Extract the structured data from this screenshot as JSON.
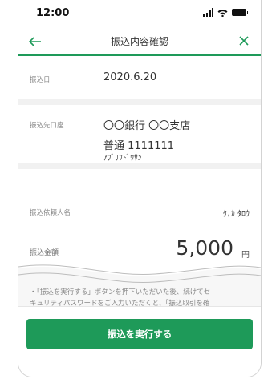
{
  "status": {
    "time": "12:00"
  },
  "header": {
    "title": "振込内容確認"
  },
  "transfer_date": {
    "label": "振込日",
    "value": "2020.6.20"
  },
  "destination": {
    "label": "振込先口座",
    "bank": "〇〇銀行 〇〇支店",
    "account": "普通 1111111",
    "holder": "ｱﾌﾟﾘﾌﾄﾞｳｻﾝ"
  },
  "requester": {
    "label": "振込依頼人名",
    "value": "ﾀﾅｶ ﾀﾛｳ"
  },
  "amount": {
    "label": "振込金額",
    "value": "5,000",
    "unit": "円"
  },
  "notice": {
    "line1": "・「振込を実行する」ボタンを押下いただいた後、続けてセ",
    "line2": "キュリティパスワードをご入力いただくと、「振込取引を確"
  },
  "actions": {
    "execute_label": "振込を実行する"
  },
  "colors": {
    "accent": "#1e9a59"
  }
}
